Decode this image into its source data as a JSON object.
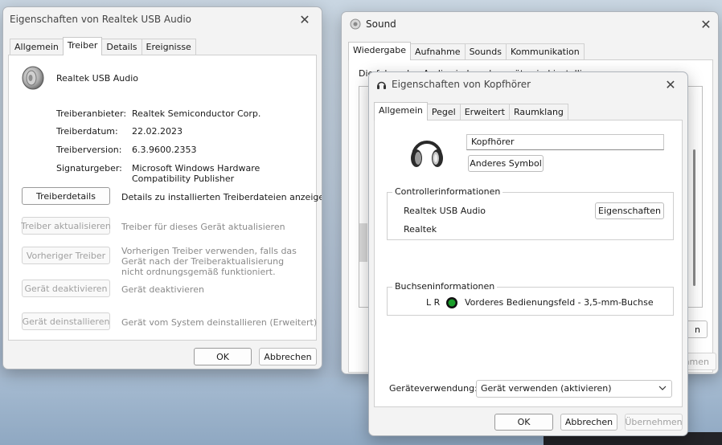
{
  "w1": {
    "title": "Eigenschaften von Realtek USB Audio",
    "tabs": [
      "Allgemein",
      "Treiber",
      "Details",
      "Ereignisse"
    ],
    "device_name": "Realtek USB Audio",
    "props": [
      {
        "label": "Treiberanbieter:",
        "value": "Realtek Semiconductor Corp."
      },
      {
        "label": "Treiberdatum:",
        "value": "22.02.2023"
      },
      {
        "label": "Treiberversion:",
        "value": "6.3.9600.2353"
      },
      {
        "label": "Signaturgeber:",
        "value": "Microsoft Windows Hardware Compatibility Publisher"
      }
    ],
    "actions": [
      {
        "button": "Treiberdetails",
        "desc": "Details zu installierten Treiberdateien anzeigen"
      },
      {
        "button": "Treiber aktualisieren",
        "desc": "Treiber für dieses Gerät aktualisieren"
      },
      {
        "button": "Vorheriger Treiber",
        "desc": "Vorherigen Treiber verwenden, falls das Gerät nach der Treiberaktualisierung nicht ordnungsgemäß funktioniert."
      },
      {
        "button": "Gerät deaktivieren",
        "desc": "Gerät deaktivieren"
      },
      {
        "button": "Gerät deinstallieren",
        "desc": "Gerät vom System deinstallieren (Erweitert)"
      }
    ],
    "ok": "OK",
    "cancel": "Abbrechen"
  },
  "w2": {
    "title": "Sound",
    "tabs": [
      "Wiedergabe",
      "Aufnahme",
      "Sounds",
      "Kommunikation"
    ],
    "intro_partial": "Die folgenden Audiowiedergabegeräte sind installiert:",
    "btn_partial": "n",
    "apply_partial": "hmen"
  },
  "w3": {
    "title": "Eigenschaften von Kopfhörer",
    "tabs": [
      "Allgemein",
      "Pegel",
      "Erweitert",
      "Raumklang"
    ],
    "name_value": "Kopfhörer",
    "change_icon": "Anderes Symbol",
    "controller_title": "Controllerinformationen",
    "controller_name": "Realtek USB Audio",
    "controller_vendor": "Realtek",
    "properties_button": "Eigenschaften",
    "jack_title": "Buchseninformationen",
    "jack_lr": "L R",
    "jack_desc": "Vorderes Bedienungsfeld - 3,5-mm-Buchse",
    "usage_label": "Geräteverwendung:",
    "usage_value": "Gerät verwenden (aktivieren)",
    "ok": "OK",
    "cancel": "Abbrechen",
    "apply": "Übernehmen"
  },
  "colors": {
    "jack_green": "#1a9e2a",
    "accent_blue": "#0067c0"
  }
}
